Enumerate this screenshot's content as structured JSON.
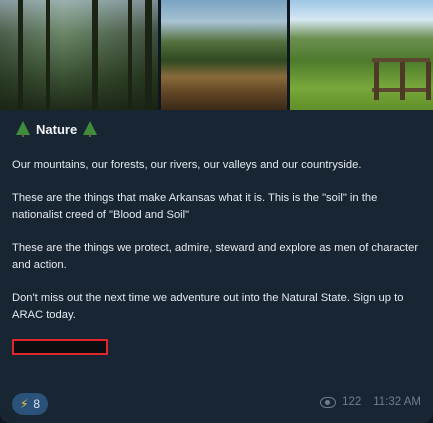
{
  "post": {
    "title": "Nature",
    "paragraphs": [
      "Our mountains, our forests, our rivers, our valleys and our countryside.",
      "These are the things that make Arkansas what it is. This is the \"soil\" in the nationalist creed of \"Blood and Soil\"",
      "These are the things we protect, admire, steward and explore as men of character and action.",
      "Don't miss out the next time we adventure out into the Natural State. Sign up to ARAC today."
    ],
    "reaction": {
      "icon": "lightning-icon",
      "count": "8"
    },
    "views": "122",
    "time": "11:32 AM"
  },
  "colors": {
    "background": "#0e1621",
    "bubble": "#182533",
    "reaction_bg": "#2b5278",
    "redaction_border": "#e0262b"
  }
}
